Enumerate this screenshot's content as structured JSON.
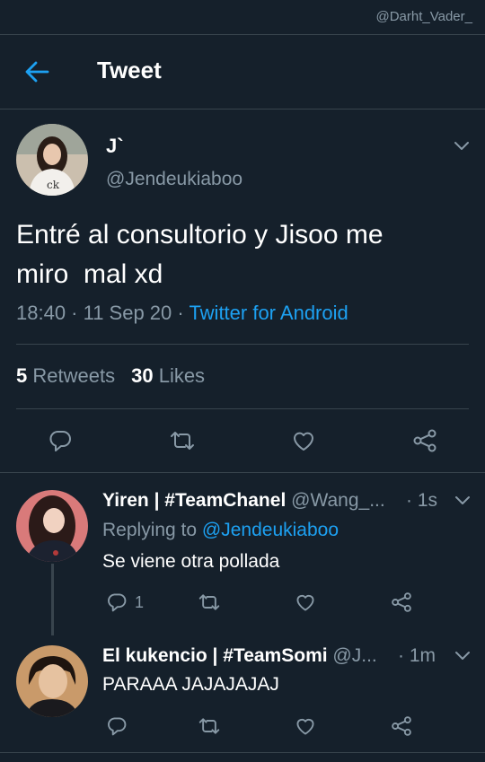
{
  "watermark": "@Darht_Vader_",
  "header": {
    "title": "Tweet"
  },
  "tweet": {
    "name": "J`",
    "handle": "@Jendeukiaboo",
    "text": "Entré al consultorio y Jisoo me\nmiro  mal xd",
    "time": "18:40 · 11 Sep 20 · ",
    "source": "Twitter for Android",
    "retweets_count": "5",
    "retweets_label": "Retweets",
    "likes_count": "30",
    "likes_label": "Likes"
  },
  "replies": [
    {
      "name": "Yiren | #TeamChanel",
      "handle": "@Wang_...",
      "time": "· 1s",
      "replying_prefix": "Replying to ",
      "replying_to": "@Jendeukiaboo",
      "text": "Se viene otra pollada",
      "reply_count": "1"
    },
    {
      "name": "El kukencio | #TeamSomi",
      "handle": "@J...",
      "time": "· 1m",
      "text": "PARAAA JAJAJAJAJ"
    }
  ],
  "colors": {
    "background": "#15202b",
    "accent": "#1da1f2",
    "secondary_text": "#8899a6",
    "divider": "#38444d"
  },
  "icons": [
    "back-arrow-icon",
    "chevron-down-icon",
    "reply-icon",
    "retweet-icon",
    "like-icon",
    "share-icon"
  ]
}
